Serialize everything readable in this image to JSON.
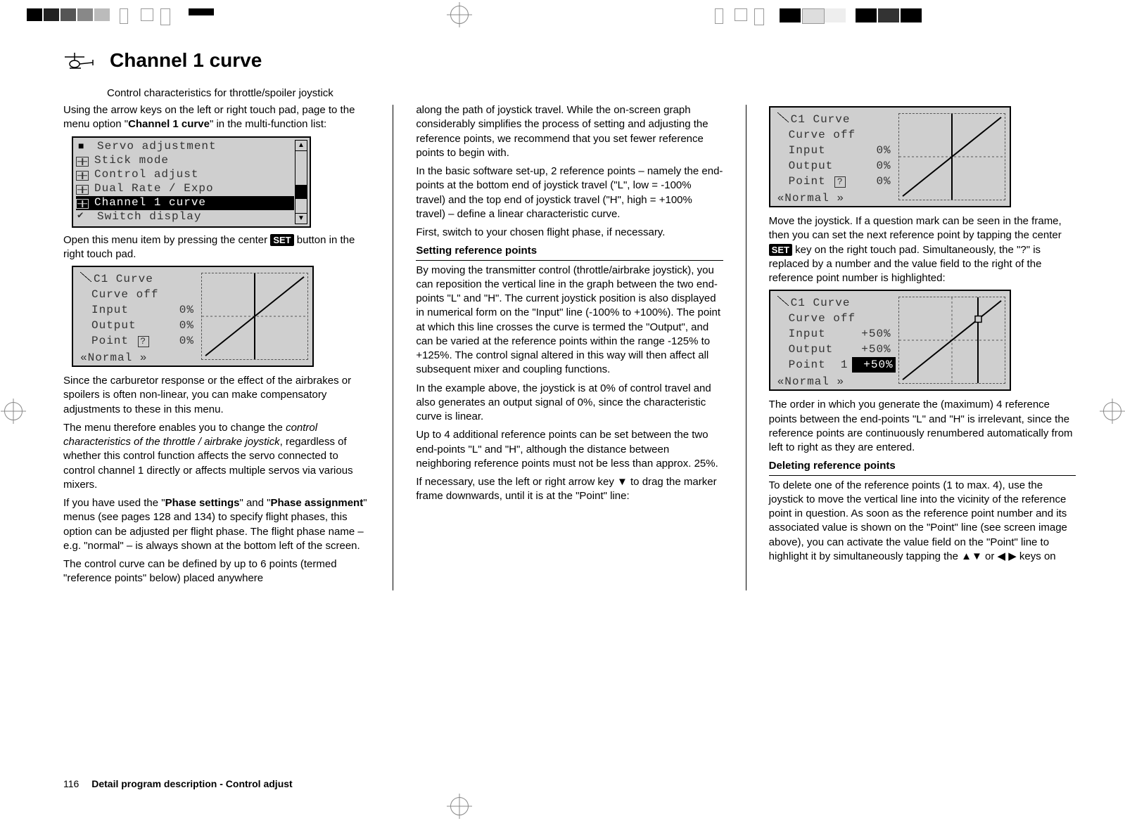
{
  "header": {
    "title": "Channel 1 curve",
    "subtitle": "Control characteristics for throttle/spoiler joystick"
  },
  "footer": {
    "page_number": "116",
    "section": "Detail program description - Control adjust"
  },
  "menu": {
    "items": [
      {
        "label": "Servo adjustment",
        "icon": "servo"
      },
      {
        "label": "Stick mode",
        "icon": "stick"
      },
      {
        "label": "Control adjust",
        "icon": "stick"
      },
      {
        "label": "Dual Rate / Expo",
        "icon": "stick"
      },
      {
        "label": "Channel 1 curve",
        "icon": "stick",
        "selected": true
      },
      {
        "label": "Switch display",
        "icon": "switch"
      }
    ]
  },
  "lcd1": {
    "title": "C1  Curve",
    "mode": "Curve off",
    "rows": {
      "input_label": "Input",
      "input_value": "0%",
      "output_label": "Output",
      "output_value": "0%",
      "point_label": "Point",
      "point_symbol": "?",
      "point_value": "0%"
    },
    "footer": "«Normal  »"
  },
  "lcd2": {
    "title": "C1  Curve",
    "mode": "Curve off",
    "rows": {
      "input_label": "Input",
      "input_value": "0%",
      "output_label": "Output",
      "output_value": "0%",
      "point_label": "Point",
      "point_symbol": "?",
      "point_value": "0%"
    },
    "footer": "«Normal  »"
  },
  "lcd3": {
    "title": "C1  Curve",
    "mode": "Curve off",
    "rows": {
      "input_label": "Input",
      "input_value": "+50%",
      "output_label": "Output",
      "output_value": "+50%",
      "point_label": "Point",
      "point_num": "1",
      "point_value": "+50%"
    },
    "footer": "«Normal  »"
  },
  "col1": {
    "p1a": "Using the arrow keys on the left or right touch pad, page to the menu option \"",
    "p1b": "Channel 1 curve",
    "p1c": "\" in the multi-function list:",
    "p2a": "Open this menu item by pressing the center ",
    "p2b": " button in the right touch pad.",
    "p3": "Since the carburetor response or the effect of the airbrakes or spoilers is often non-linear, you can make compensatory adjustments to these in this menu.",
    "p4a": "The menu therefore enables you to change the ",
    "p4b": "control characteristics of the throttle / airbrake joystick",
    "p4c": ", regardless of whether this control function affects the servo connected to control channel 1 directly or affects multiple servos via various mixers.",
    "p5a": "If you have used the \"",
    "p5b": "Phase settings",
    "p5c": "\" and \"",
    "p5d": "Phase assignment",
    "p5e": "\" menus (see pages 128 and 134) to specify flight phases, this option can be adjusted per flight phase. The flight phase name – e.g. \"normal\" – is always shown at the bottom left of the screen.",
    "p6": "The control curve can be defined by up to 6 points (termed \"reference points\" below) placed anywhere"
  },
  "col2": {
    "p1": "along the path of joystick travel. While the on-screen graph considerably simplifies the process of setting and adjusting the reference points, we recommend that you set fewer reference points to begin with.",
    "p2": "In the basic software set-up, 2 reference points – namely the end-points at the bottom end of joystick travel (\"L\", low = -100% travel) and the top end of joystick travel (\"H\", high = +100% travel) – define a linear characteristic curve.",
    "p3": "First, switch to your chosen flight phase, if necessary.",
    "h1": "Setting reference points",
    "p4": "By moving the transmitter control (throttle/airbrake joystick), you can reposition the vertical line in the graph between the two end-points \"L\" and \"H\". The current joystick position is also displayed in numerical form on the \"Input\" line (-100% to +100%). The point at which this line crosses the curve is termed the \"Output\", and can be varied at the reference points within the range -125% to +125%. The control signal altered in this way will then affect all subsequent mixer and coupling functions.",
    "p5": "In the example above, the joystick is at 0% of control travel and also generates an output signal of 0%, since the characteristic curve is linear.",
    "p6": "Up to 4 additional reference points can be set between the two end-points \"L\" and \"H\", although the distance between neighboring reference points must not be less than approx. 25%.",
    "p7": "If necessary, use the left or right arrow key ▼ to drag the marker frame downwards, until it is at the \"Point\" line:"
  },
  "col3": {
    "p1a": "Move the joystick. If a question mark can be seen in the frame, then you can set the next reference point by tapping the center ",
    "p1b": " key on the right touch pad. Simultaneously, the \"?\" is replaced by a number and the value field to the right of the reference point number is highlighted:",
    "p2": "The order in which you generate the (maximum) 4 reference points between the end-points \"L\" and \"H\" is irrelevant, since the reference points are continuously renumbered automatically from left to right as they are entered.",
    "h1": "Deleting reference points",
    "p3": "To delete one of the reference points (1 to max. 4), use the joystick to move the vertical line into the vicinity of the reference point in question. As soon as the reference point number and its associated value is shown on the \"Point\" line (see screen image above), you can activate the value field on the \"Point\" line to highlight it by simultaneously tapping the ▲▼ or ◀ ▶ keys on"
  },
  "set_label": "SET"
}
